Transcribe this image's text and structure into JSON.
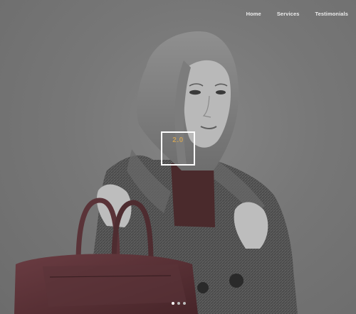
{
  "nav": {
    "items": [
      {
        "label": "Home"
      },
      {
        "label": "Services"
      },
      {
        "label": "Testimonials"
      }
    ]
  },
  "logo": {
    "text": "2.0",
    "text_color": "#c9a15a",
    "border_color": "#ffffff"
  },
  "slider": {
    "dot_count": 3,
    "active_index": 0
  },
  "colors": {
    "background": "#7a7a7a",
    "nav_text": "#ececec",
    "bag": "#5a3338",
    "sweater": "#4a2a2c",
    "coat": "#555555"
  }
}
